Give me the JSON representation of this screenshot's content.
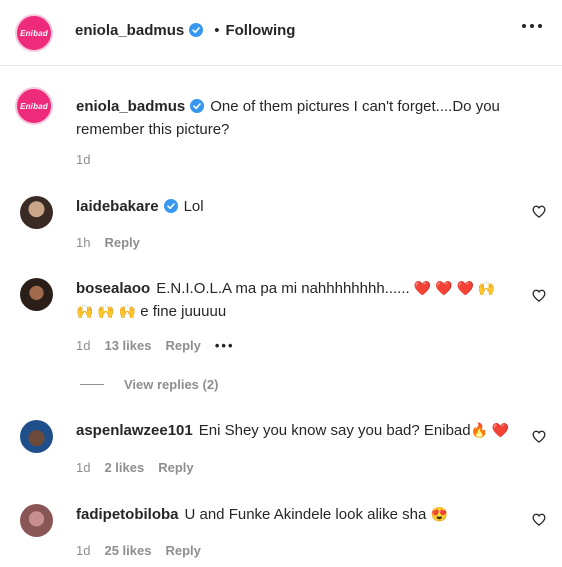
{
  "header": {
    "username": "eniola_badmus",
    "separator": "•",
    "follow_status": "Following",
    "avatar_logo": "Enibad"
  },
  "caption": {
    "username": "eniola_badmus",
    "text": "One of them pictures I can't forget....Do you remember this picture?",
    "time": "1d"
  },
  "comments": [
    {
      "username": "laidebakare",
      "verified": true,
      "text": "Lol",
      "time": "1h",
      "likes": "",
      "reply": "Reply"
    },
    {
      "username": "bosealaoo",
      "verified": false,
      "text": "E.N.I.O.L.A ma pa mi nahhhhhhhh......",
      "text_emojis": "❤️ ❤️ ❤️ 🙌",
      "text_line2_emojis": "🙌 🙌 🙌",
      "text_line2": "e fine juuuuu",
      "time": "1d",
      "likes": "13 likes",
      "reply": "Reply",
      "more": "•••",
      "view_replies": "View replies (2)"
    },
    {
      "username": "aspenlawzee101",
      "verified": false,
      "text": "Eni Shey you know say you bad? Enibad",
      "text_emojis": "🔥 ❤️",
      "time": "1d",
      "likes": "2 likes",
      "reply": "Reply"
    },
    {
      "username": "fadipetobiloba",
      "verified": false,
      "text": "U and Funke Akindele look alike sha",
      "text_emojis": "😍",
      "time": "1d",
      "likes": "25 likes",
      "reply": "Reply"
    }
  ],
  "colors": {
    "brand_pink": "#ee2a7b",
    "verified_blue": "#3897f0",
    "muted_text": "#8e8e8e",
    "primary_text": "#262626"
  },
  "icons": [
    "verified-badge-icon",
    "more-options-icon",
    "heart-icon"
  ]
}
